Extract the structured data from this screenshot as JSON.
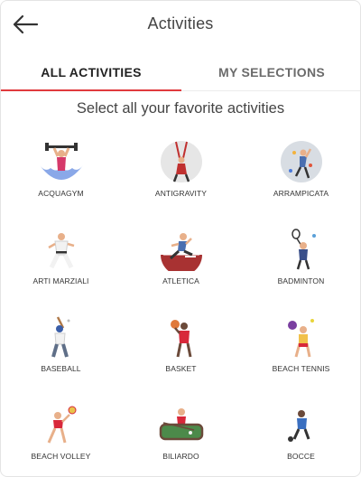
{
  "header": {
    "title": "Activities",
    "back_icon": "arrow-left-icon"
  },
  "tabs": [
    {
      "label": "ALL ACTIVITIES",
      "active": true
    },
    {
      "label": "MY SELECTIONS",
      "active": false
    }
  ],
  "accent_color": "#e03a3e",
  "subtitle": "Select all your favorite activities",
  "activities": [
    {
      "label": "ACQUAGYM",
      "icon": "acquagym-icon"
    },
    {
      "label": "ANTIGRAVITY",
      "icon": "antigravity-icon"
    },
    {
      "label": "ARRAMPICATA",
      "icon": "climbing-icon"
    },
    {
      "label": "ARTI MARZIALI",
      "icon": "martial-arts-icon"
    },
    {
      "label": "ATLETICA",
      "icon": "athletics-icon"
    },
    {
      "label": "BADMINTON",
      "icon": "badminton-icon"
    },
    {
      "label": "BASEBALL",
      "icon": "baseball-icon"
    },
    {
      "label": "BASKET",
      "icon": "basketball-icon"
    },
    {
      "label": "BEACH TENNIS",
      "icon": "beach-tennis-icon"
    },
    {
      "label": "BEACH VOLLEY",
      "icon": "beach-volley-icon"
    },
    {
      "label": "BILIARDO",
      "icon": "billiards-icon"
    },
    {
      "label": "BOCCE",
      "icon": "bocce-icon"
    }
  ]
}
